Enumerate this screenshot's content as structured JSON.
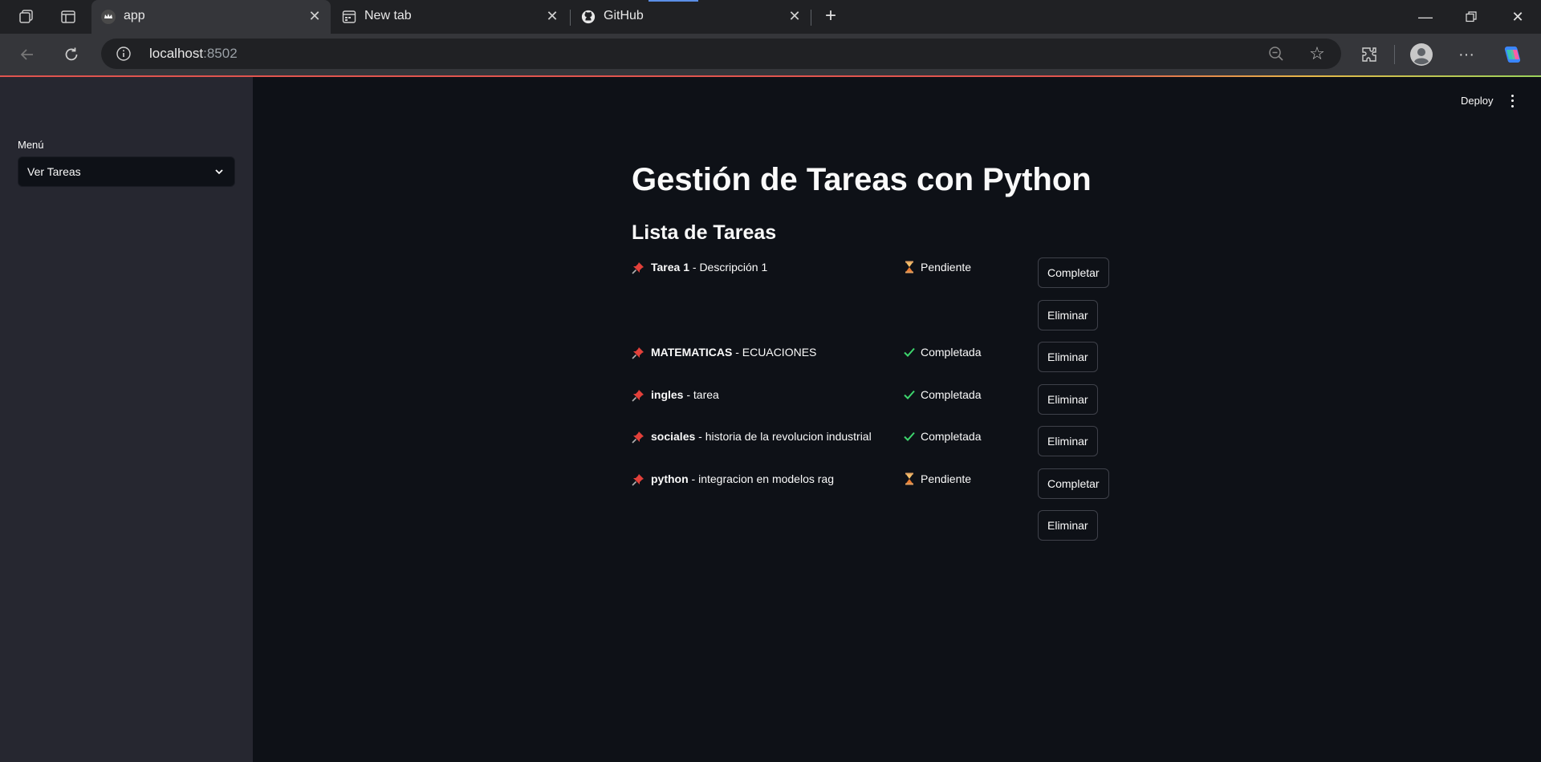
{
  "browser": {
    "tabs": [
      {
        "label": "app",
        "active": true
      },
      {
        "label": "New tab",
        "active": false
      },
      {
        "label": "GitHub",
        "active": false
      }
    ],
    "url_host": "localhost",
    "url_port": ":8502"
  },
  "app": {
    "sidebar": {
      "menu_label": "Menú",
      "menu_selected": "Ver Tareas"
    },
    "header": {
      "deploy_label": "Deploy"
    },
    "title": "Gestión de Tareas con Python",
    "subtitle": "Lista de Tareas",
    "tasks": [
      {
        "name": "Tarea 1",
        "description": " - Descripción 1",
        "status": "Pendiente",
        "state": "pending"
      },
      {
        "name": "MATEMATICAS",
        "description": " - ECUACIONES",
        "status": "Completada",
        "state": "done"
      },
      {
        "name": "ingles",
        "description": " - tarea",
        "status": "Completada",
        "state": "done"
      },
      {
        "name": "sociales",
        "description": " - historia de la revolucion industrial",
        "status": "Completada",
        "state": "done"
      },
      {
        "name": "python",
        "description": " - integracion en modelos rag",
        "status": "Pendiente",
        "state": "pending"
      }
    ],
    "buttons": {
      "complete_label": "Completar",
      "delete_label": "Eliminar"
    }
  }
}
